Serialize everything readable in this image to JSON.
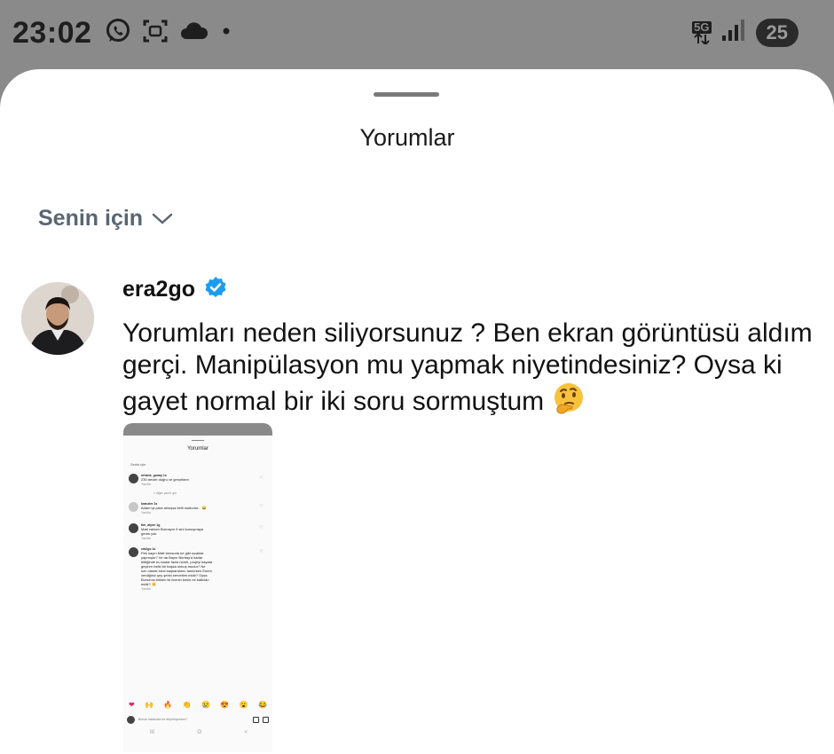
{
  "status_bar": {
    "time": "23:02",
    "network": "5G",
    "battery": "25",
    "left_icons": [
      "whatsapp-icon",
      "screenshot-icon",
      "cloud-icon",
      "dot-icon"
    ],
    "right_icons": [
      "5g-icon",
      "signal-icon",
      "battery-icon"
    ]
  },
  "sheet": {
    "title": "Yorumlar",
    "filter_label": "Senin için"
  },
  "comment": {
    "username": "era2go",
    "verified": true,
    "text": "Yorumları neden siliyorsunuz ? Ben ekran görüntüsü aldım gerçi. Manipülasyon mu yapmak niyetindesiniz? Oysa ki gayet normal bir iki soru sormuştum",
    "emoji": "thinking-face-icon"
  },
  "attachment": {
    "title": "Yorumlar",
    "filter_label": "Senin için",
    "comments": [
      {
        "name": "orhans_gunay 1s",
        "lines": [
          "230 devlet doğru ve gerçekten"
        ],
        "reply": "Yanıtla",
        "more": "1 diğer yanıtı gör"
      },
      {
        "name": "kranzler 2s",
        "lines": [
          "Adam iyi para almışsa belli mutludur... 😂"
        ],
        "reply": "Yanıtla"
      },
      {
        "name": "tim_alynn 1g",
        "lines": [
          "Matt varken Burnaym 9 sini konuşmaya",
          "gerek yok"
        ],
        "reply": "Yanıtla"
      },
      {
        "name": "era2go 1s",
        "lines": [
          "Pek sayın Matt bensuda ne gibi sıcaklar",
          "yapmıştır? Ve da Bayın Burbay'a kadar",
          "bittiğinde bu kadar fazla ücreti, projeyi kayata",
          "geçiren belki bir başka olmuş mudur? Ne",
          "son olarak bizsi başkanlarını tanıtırken Enem",
          "verdiğiniz şey şehsi servetleri midir? Oysa",
          "Bursa'da bilinen iki ilcenin kesin ne katkıları",
          "midir? 🙂"
        ],
        "reply": "Yanıtla"
      }
    ],
    "emoji_bar": [
      "❤",
      "🙌",
      "🔥",
      "👏",
      "😢",
      "😍",
      "😮",
      "😂"
    ],
    "input_placeholder": "Bunun hakkında ne düşünüyorsun?",
    "nav": [
      "III",
      "O",
      "<"
    ]
  }
}
